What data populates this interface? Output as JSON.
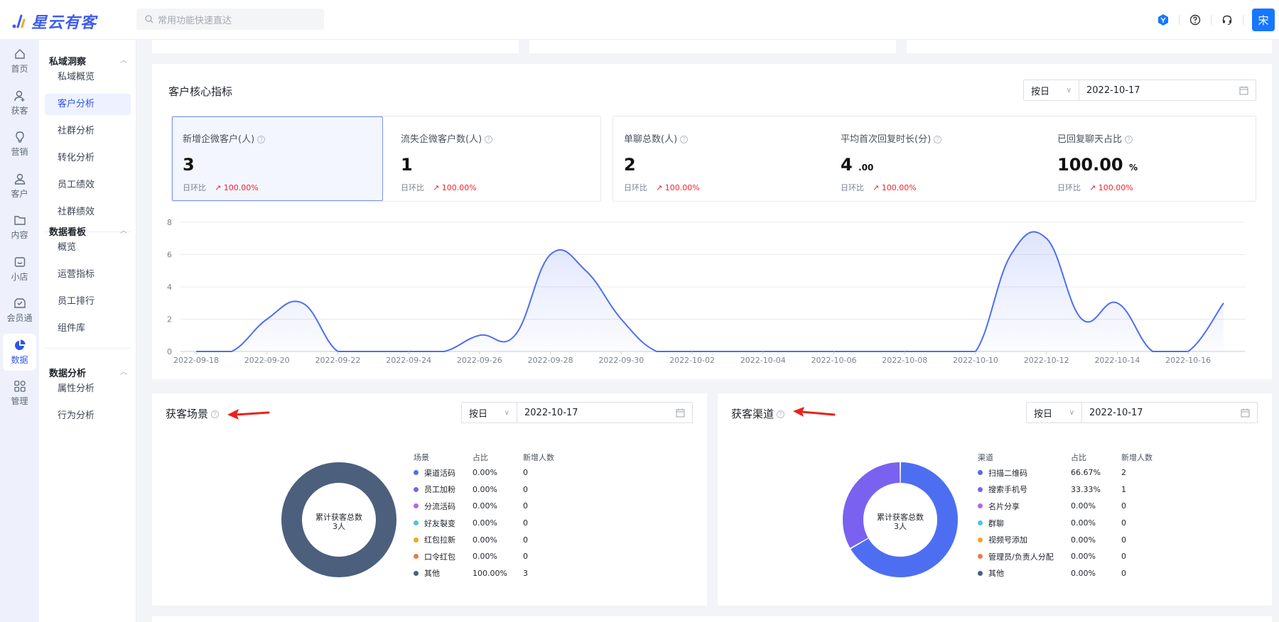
{
  "app": {
    "name": "星云有客",
    "search_placeholder": "常用功能快速直达",
    "user_initial": "宋"
  },
  "colors": {
    "accent": "#2f54eb",
    "line": "#4e6ef2",
    "up": "#f5222d"
  },
  "rail": [
    {
      "label": "首页",
      "icon": "home-icon"
    },
    {
      "label": "获客",
      "icon": "user-add-icon"
    },
    {
      "label": "营销",
      "icon": "bulb-icon"
    },
    {
      "label": "客户",
      "icon": "user-icon"
    },
    {
      "label": "内容",
      "icon": "folder-icon"
    },
    {
      "label": "小店",
      "icon": "shop-icon"
    },
    {
      "label": "会员通",
      "icon": "member-icon"
    },
    {
      "label": "数据",
      "icon": "pie-chart-icon",
      "active": true
    },
    {
      "label": "管理",
      "icon": "grid-icon"
    }
  ],
  "subnav": {
    "groups": [
      {
        "title": "私域洞察",
        "items": [
          "私域概览",
          "客户分析",
          "社群分析",
          "转化分析",
          "员工绩效",
          "社群绩效"
        ]
      },
      {
        "title": "数据看板",
        "items": [
          "概览",
          "运营指标",
          "员工排行",
          "组件库"
        ]
      },
      {
        "title": "数据分析",
        "items": [
          "属性分析",
          "行为分析"
        ]
      }
    ],
    "active": "客户分析"
  },
  "core": {
    "title": "客户核心指标",
    "mode": "按日",
    "date": "2022-10-17",
    "kpis": [
      {
        "label": "新增企微客户(人)",
        "value": "3",
        "suffix": "",
        "cmp_label": "日环比",
        "cmp": "100.00%"
      },
      {
        "label": "流失企微客户数(人)",
        "value": "1",
        "suffix": "",
        "cmp_label": "日环比",
        "cmp": "100.00%"
      },
      {
        "label": "单聊总数(人)",
        "value": "2",
        "suffix": "",
        "cmp_label": "日环比",
        "cmp": "100.00%"
      },
      {
        "label": "平均首次回复时长(分)",
        "value": "4",
        "suffix": ".00",
        "cmp_label": "日环比",
        "cmp": "100.00%"
      },
      {
        "label": "已回复聊天占比",
        "value": "100.00",
        "suffix": "%",
        "cmp_label": "日环比",
        "cmp": "100.00%"
      }
    ]
  },
  "chart_data": {
    "type": "area",
    "x": [
      "2022-09-18",
      "2022-09-19",
      "2022-09-20",
      "2022-09-21",
      "2022-09-22",
      "2022-09-23",
      "2022-09-24",
      "2022-09-25",
      "2022-09-26",
      "2022-09-27",
      "2022-09-28",
      "2022-09-29",
      "2022-09-30",
      "2022-10-01",
      "2022-10-02",
      "2022-10-03",
      "2022-10-04",
      "2022-10-05",
      "2022-10-06",
      "2022-10-07",
      "2022-10-08",
      "2022-10-09",
      "2022-10-10",
      "2022-10-11",
      "2022-10-12",
      "2022-10-13",
      "2022-10-14",
      "2022-10-15",
      "2022-10-16",
      "2022-10-17"
    ],
    "values": [
      0,
      0,
      2,
      3,
      0,
      0,
      0,
      0,
      1,
      1,
      6,
      5,
      2,
      0,
      0,
      0,
      0,
      0,
      0,
      0,
      0,
      0,
      0,
      6,
      7,
      2,
      3,
      0,
      0,
      3
    ],
    "xticks": [
      "2022-09-18",
      "2022-09-20",
      "2022-09-22",
      "2022-09-24",
      "2022-09-26",
      "2022-09-28",
      "2022-09-30",
      "2022-10-02",
      "2022-10-04",
      "2022-10-06",
      "2022-10-08",
      "2022-10-10",
      "2022-10-12",
      "2022-10-14",
      "2022-10-16"
    ],
    "yticks": [
      "0",
      "2",
      "4",
      "6",
      "8"
    ],
    "ylim": [
      0,
      8
    ],
    "grid": true
  },
  "scene": {
    "title": "获客场景",
    "mode": "按日",
    "date": "2022-10-17",
    "center": "累计获客总数",
    "total": "3人",
    "headers": [
      "场景",
      "占比",
      "新增人数"
    ],
    "rows": [
      {
        "name": "渠道活码",
        "pct": "0.00%",
        "count": "0",
        "color": "#4e6ef2"
      },
      {
        "name": "员工加粉",
        "pct": "0.00%",
        "count": "0",
        "color": "#7b61f0"
      },
      {
        "name": "分流活码",
        "pct": "0.00%",
        "count": "0",
        "color": "#b06ae0"
      },
      {
        "name": "好友裂变",
        "pct": "0.00%",
        "count": "0",
        "color": "#4fc1e8"
      },
      {
        "name": "红包拉新",
        "pct": "0.00%",
        "count": "0",
        "color": "#f5a623"
      },
      {
        "name": "口令红包",
        "pct": "0.00%",
        "count": "0",
        "color": "#f0784a"
      },
      {
        "name": "其他",
        "pct": "100.00%",
        "count": "3",
        "color": "#4c5f7c"
      }
    ]
  },
  "channel": {
    "title": "获客渠道",
    "mode": "按日",
    "date": "2022-10-17",
    "center": "累计获客总数",
    "total": "3人",
    "headers": [
      "渠道",
      "占比",
      "新增人数"
    ],
    "rows": [
      {
        "name": "扫描二维码",
        "pct": "66.67%",
        "count": "2",
        "color": "#4e6ef2"
      },
      {
        "name": "搜索手机号",
        "pct": "33.33%",
        "count": "1",
        "color": "#7b61f0"
      },
      {
        "name": "名片分享",
        "pct": "0.00%",
        "count": "0",
        "color": "#b06ae0"
      },
      {
        "name": "群聊",
        "pct": "0.00%",
        "count": "0",
        "color": "#4fc1e8"
      },
      {
        "name": "视频号添加",
        "pct": "0.00%",
        "count": "0",
        "color": "#f5a623"
      },
      {
        "name": "管理员/负责人分配",
        "pct": "0.00%",
        "count": "0",
        "color": "#f0784a"
      },
      {
        "name": "其他",
        "pct": "0.00%",
        "count": "0",
        "color": "#4c5f7c"
      }
    ]
  }
}
